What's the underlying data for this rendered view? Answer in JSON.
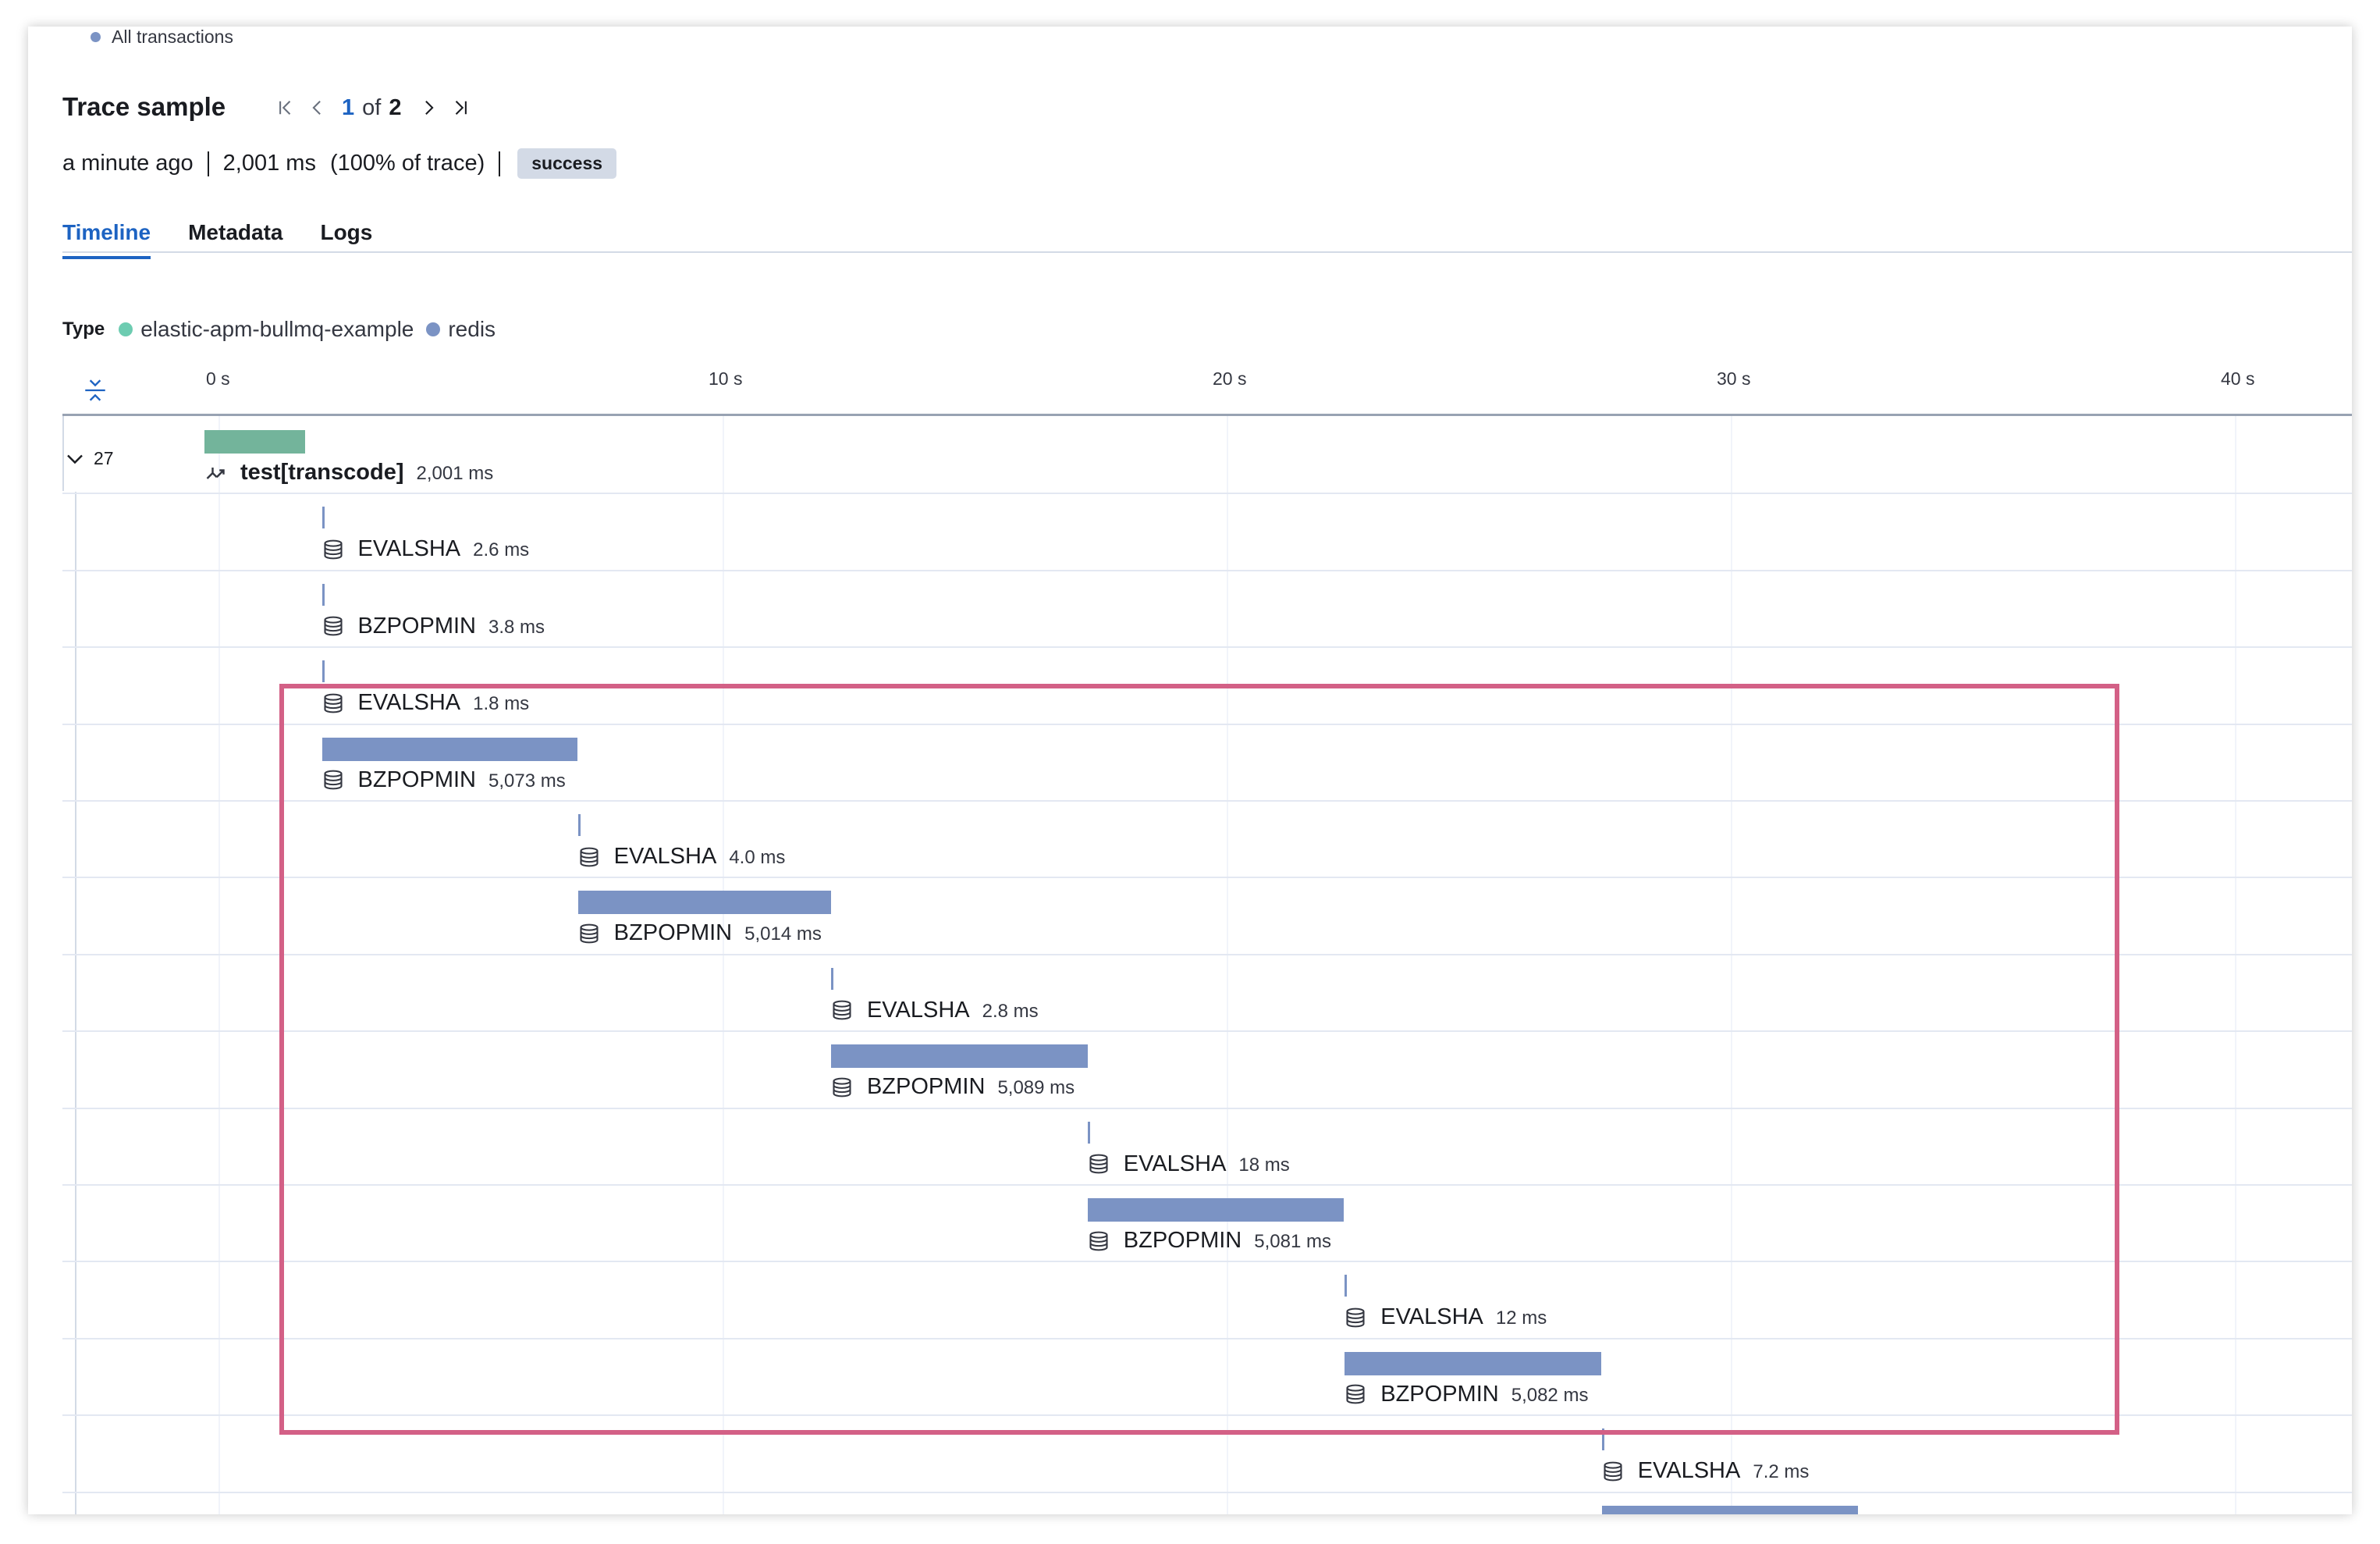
{
  "top": {
    "all_transactions": "All transactions"
  },
  "header": {
    "title": "Trace sample",
    "pager": {
      "current": "1",
      "of": "of",
      "total": "2"
    },
    "summary": {
      "time_ago": "a minute ago",
      "duration": "2,001 ms",
      "percent": "(100% of trace)",
      "status": "success"
    }
  },
  "tabs": [
    {
      "label": "Timeline",
      "active": true
    },
    {
      "label": "Metadata",
      "active": false
    },
    {
      "label": "Logs",
      "active": false
    }
  ],
  "type_legend": {
    "label": "Type",
    "items": [
      {
        "name": "elastic-apm-bullmq-example",
        "color": "#6dccb1"
      },
      {
        "name": "redis",
        "color": "#7b93c4"
      }
    ]
  },
  "axis": {
    "ticks": [
      "0 s",
      "10 s",
      "20 s",
      "30 s",
      "40 s"
    ],
    "max_seconds": 40
  },
  "root_toggle": {
    "count": "27"
  },
  "colors": {
    "service": "#73b49b",
    "redis": "#7b93c4",
    "highlight": "#d36086",
    "link": "#1d63c2"
  },
  "spans": [
    {
      "name": "test[transcode]",
      "duration": "2,001 ms",
      "start_s": 0.0,
      "dur_s": 2.001,
      "kind": "transaction"
    },
    {
      "name": "EVALSHA",
      "duration": "2.6 ms",
      "start_s": 2.33,
      "dur_s": 0.0026,
      "kind": "redis"
    },
    {
      "name": "BZPOPMIN",
      "duration": "3.8 ms",
      "start_s": 2.33,
      "dur_s": 0.0038,
      "kind": "redis"
    },
    {
      "name": "EVALSHA",
      "duration": "1.8 ms",
      "start_s": 2.33,
      "dur_s": 0.0018,
      "kind": "redis"
    },
    {
      "name": "BZPOPMIN",
      "duration": "5,073 ms",
      "start_s": 2.33,
      "dur_s": 5.073,
      "kind": "redis"
    },
    {
      "name": "EVALSHA",
      "duration": "4.0 ms",
      "start_s": 7.41,
      "dur_s": 0.004,
      "kind": "redis"
    },
    {
      "name": "BZPOPMIN",
      "duration": "5,014 ms",
      "start_s": 7.41,
      "dur_s": 5.014,
      "kind": "redis"
    },
    {
      "name": "EVALSHA",
      "duration": "2.8 ms",
      "start_s": 12.43,
      "dur_s": 0.0028,
      "kind": "redis"
    },
    {
      "name": "BZPOPMIN",
      "duration": "5,089 ms",
      "start_s": 12.43,
      "dur_s": 5.089,
      "kind": "redis"
    },
    {
      "name": "EVALSHA",
      "duration": "18 ms",
      "start_s": 17.52,
      "dur_s": 0.018,
      "kind": "redis"
    },
    {
      "name": "BZPOPMIN",
      "duration": "5,081 ms",
      "start_s": 17.52,
      "dur_s": 5.081,
      "kind": "redis"
    },
    {
      "name": "EVALSHA",
      "duration": "12 ms",
      "start_s": 22.62,
      "dur_s": 0.012,
      "kind": "redis"
    },
    {
      "name": "BZPOPMIN",
      "duration": "5,082 ms",
      "start_s": 22.62,
      "dur_s": 5.082,
      "kind": "redis"
    },
    {
      "name": "EVALSHA",
      "duration": "7.2 ms",
      "start_s": 27.72,
      "dur_s": 0.0072,
      "kind": "redis"
    },
    {
      "name": "",
      "duration": "",
      "start_s": 27.72,
      "dur_s": 5.08,
      "kind": "redis"
    }
  ]
}
